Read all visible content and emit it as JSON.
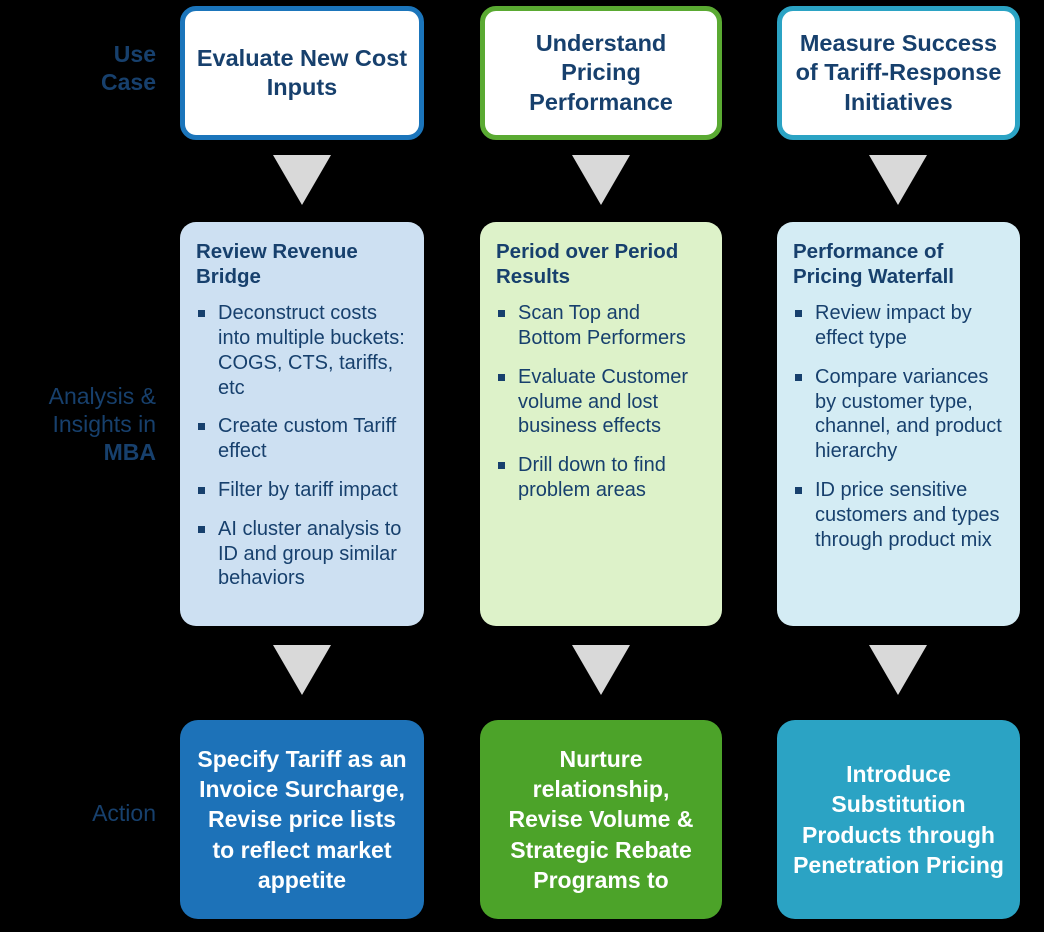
{
  "rows": {
    "use_case_label": "Use\nCase",
    "analysis_label_line1": "Analysis &",
    "analysis_label_line2": "Insights in",
    "analysis_label_bold": "MBA",
    "action_label": "Action"
  },
  "colors": {
    "background": "#000000",
    "text_dark_blue": "#17406d",
    "blue_border": "#1b75bb",
    "green_border": "#5aaa32",
    "teal_border": "#2ba3c4",
    "light_blue_fill": "#cde0f2",
    "light_green_fill": "#ddf2c9",
    "light_teal_fill": "#d4ecf4",
    "action_blue_fill": "#1d72b8",
    "action_green_fill": "#4ca329",
    "action_teal_fill": "#2ba3c4",
    "arrow_gray": "#d9d9d9"
  },
  "columns": [
    {
      "use_case": "Evaluate New Cost Inputs",
      "analysis_title": "Review Revenue Bridge",
      "analysis_bullets": [
        "Deconstruct costs into multiple buckets: COGS, CTS, tariffs, etc",
        "Create custom Tariff effect",
        "Filter by tariff impact",
        "AI cluster analysis to ID and group similar behaviors"
      ],
      "action": "Specify Tariff as an Invoice Surcharge, Revise price lists to reflect market appetite"
    },
    {
      "use_case": "Understand Pricing Performance",
      "analysis_title": "Period over Period Results",
      "analysis_bullets": [
        "Scan Top and Bottom Performers",
        "Evaluate Customer volume and lost business effects",
        "Drill down to find problem areas"
      ],
      "action": "Nurture relationship, Revise Volume & Strategic Rebate Programs to"
    },
    {
      "use_case": "Measure Success of Tariff-Response Initiatives",
      "analysis_title": "Performance of Pricing Waterfall",
      "analysis_bullets": [
        "Review impact by effect type",
        "Compare variances by customer type, channel, and product hierarchy",
        "ID price sensitive customers and types through product mix"
      ],
      "action": "Introduce Substitution Products through Penetration Pricing"
    }
  ]
}
